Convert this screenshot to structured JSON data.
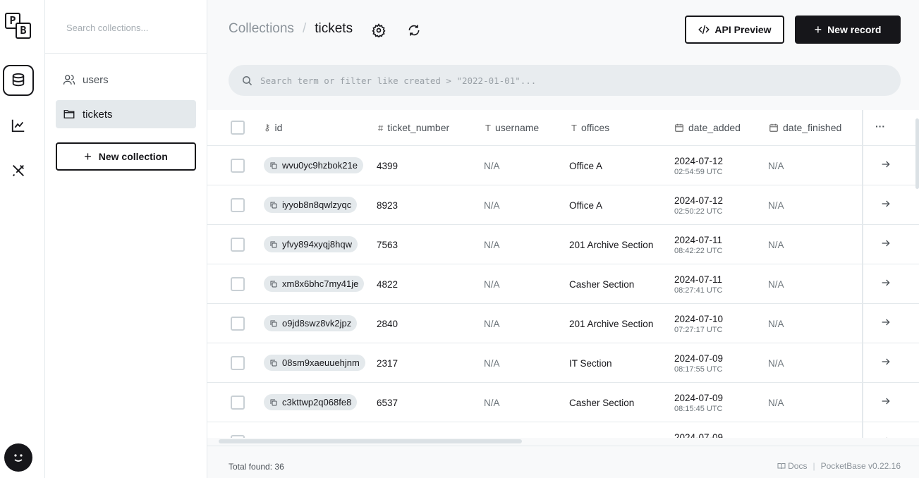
{
  "rail": {
    "logo_letter_1": "P",
    "logo_letter_2": "B",
    "items": [
      {
        "name": "collections",
        "icon": "database-icon",
        "active": true
      },
      {
        "name": "logs",
        "icon": "chart-line-icon",
        "active": false
      },
      {
        "name": "settings",
        "icon": "tools-icon",
        "active": false
      }
    ]
  },
  "sidebar": {
    "search_placeholder": "Search collections...",
    "items": [
      {
        "label": "users",
        "icon": "users-icon"
      },
      {
        "label": "tickets",
        "icon": "folder-icon",
        "active": true
      }
    ],
    "new_collection_label": "New collection"
  },
  "header": {
    "breadcrumb_root": "Collections",
    "breadcrumb_sep": "/",
    "breadcrumb_current": "tickets",
    "api_preview_label": "API Preview",
    "new_record_label": "New record"
  },
  "search": {
    "placeholder": "Search term or filter like created > \"2022-01-01\"..."
  },
  "table": {
    "columns": [
      {
        "key": "id",
        "label": "id",
        "icon": "key-icon"
      },
      {
        "key": "ticket_number",
        "label": "ticket_number",
        "icon": "hash-icon"
      },
      {
        "key": "username",
        "label": "username",
        "icon": "text-icon"
      },
      {
        "key": "offices",
        "label": "offices",
        "icon": "text-icon"
      },
      {
        "key": "date_added",
        "label": "date_added",
        "icon": "calendar-icon"
      },
      {
        "key": "date_finished",
        "label": "date_finished",
        "icon": "calendar-icon"
      }
    ],
    "more_label": "···",
    "rows": [
      {
        "id": "wvu0yc9hzbok21e",
        "ticket_number": "4399",
        "username": "N/A",
        "offices": "Office A",
        "date": "2024-07-12",
        "time": "02:54:59 UTC",
        "date_finished": "N/A"
      },
      {
        "id": "iyyob8n8qwlzyqc",
        "ticket_number": "8923",
        "username": "N/A",
        "offices": "Office A",
        "date": "2024-07-12",
        "time": "02:50:22 UTC",
        "date_finished": "N/A"
      },
      {
        "id": "yfvy894xyqj8hqw",
        "ticket_number": "7563",
        "username": "N/A",
        "offices": "201 Archive Section",
        "date": "2024-07-11",
        "time": "08:42:22 UTC",
        "date_finished": "N/A"
      },
      {
        "id": "xm8x6bhc7my41je",
        "ticket_number": "4822",
        "username": "N/A",
        "offices": "Casher Section",
        "date": "2024-07-11",
        "time": "08:27:41 UTC",
        "date_finished": "N/A"
      },
      {
        "id": "o9jd8swz8vk2jpz",
        "ticket_number": "2840",
        "username": "N/A",
        "offices": "201 Archive Section",
        "date": "2024-07-10",
        "time": "07:27:17 UTC",
        "date_finished": "N/A"
      },
      {
        "id": "08sm9xaeuuehjnm",
        "ticket_number": "2317",
        "username": "N/A",
        "offices": "IT Section",
        "date": "2024-07-09",
        "time": "08:17:55 UTC",
        "date_finished": "N/A"
      },
      {
        "id": "c3kttwp2q068fe8",
        "ticket_number": "6537",
        "username": "N/A",
        "offices": "Casher Section",
        "date": "2024-07-09",
        "time": "08:15:45 UTC",
        "date_finished": "N/A"
      },
      {
        "id": "",
        "ticket_number": "",
        "username": "",
        "offices": "",
        "date": "2024-07-09",
        "time": "",
        "date_finished": ""
      }
    ]
  },
  "footer": {
    "total_label": "Total found:",
    "total_value": "36",
    "docs_label": "Docs",
    "separator": "|",
    "version_label": "PocketBase v0.22.16"
  }
}
